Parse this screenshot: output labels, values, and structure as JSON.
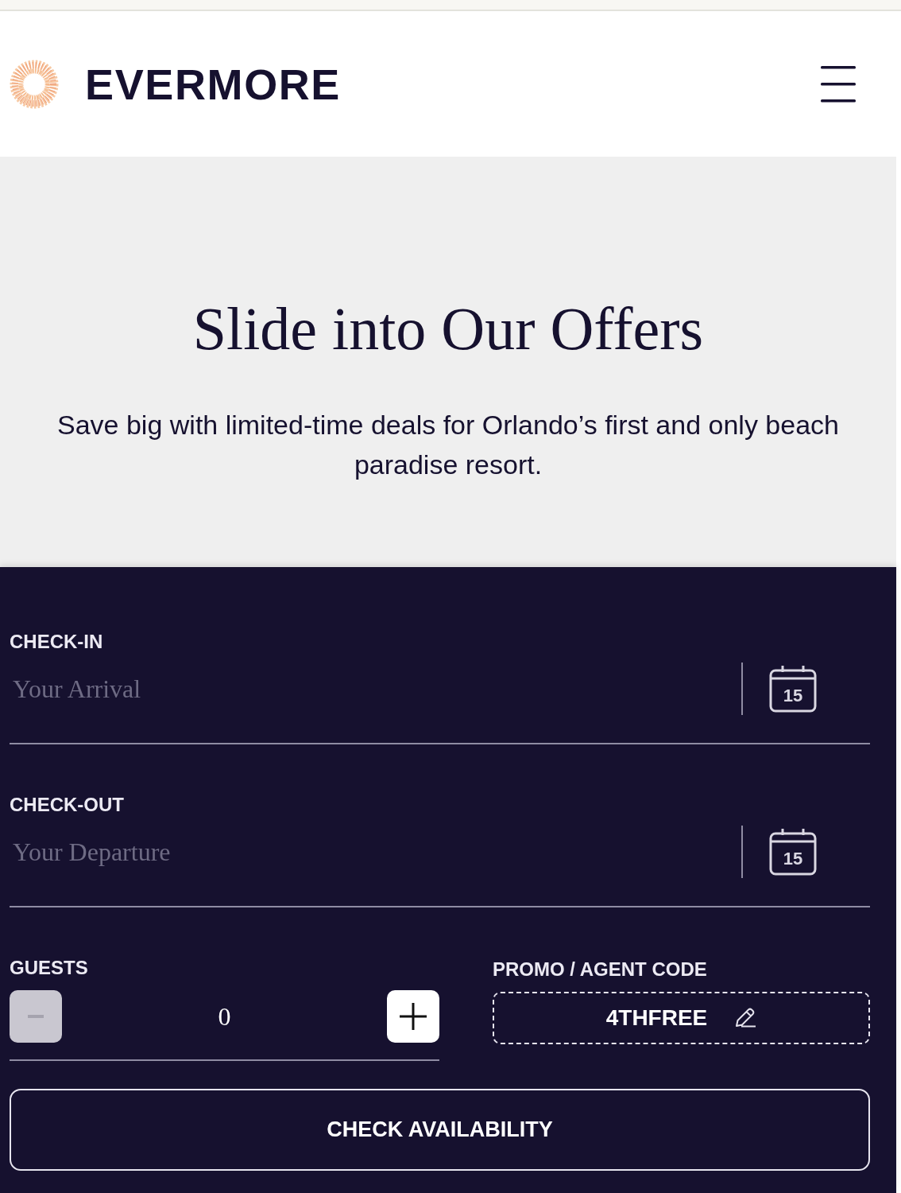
{
  "header": {
    "logo_text": "EVERMORE"
  },
  "hero": {
    "title": "Slide into Our Offers",
    "subtitle": "Save big with limited-time deals for Orlando’s first and only beach paradise resort."
  },
  "booking_form": {
    "date_fields": [
      {
        "label": "CHECK-IN",
        "placeholder": "Your Arrival",
        "calendar_day": "15"
      },
      {
        "label": "CHECK-OUT",
        "placeholder": "Your Departure",
        "calendar_day": "15"
      }
    ],
    "guests": {
      "label": "GUESTS",
      "value": "0",
      "decrement": {
        "disabled": true
      },
      "increment": {
        "disabled": false
      }
    },
    "promo": {
      "label": "PROMO / AGENT CODE",
      "value": "4THFREE"
    },
    "submit": {
      "label": "CHECK AVAILABILITY"
    }
  }
}
